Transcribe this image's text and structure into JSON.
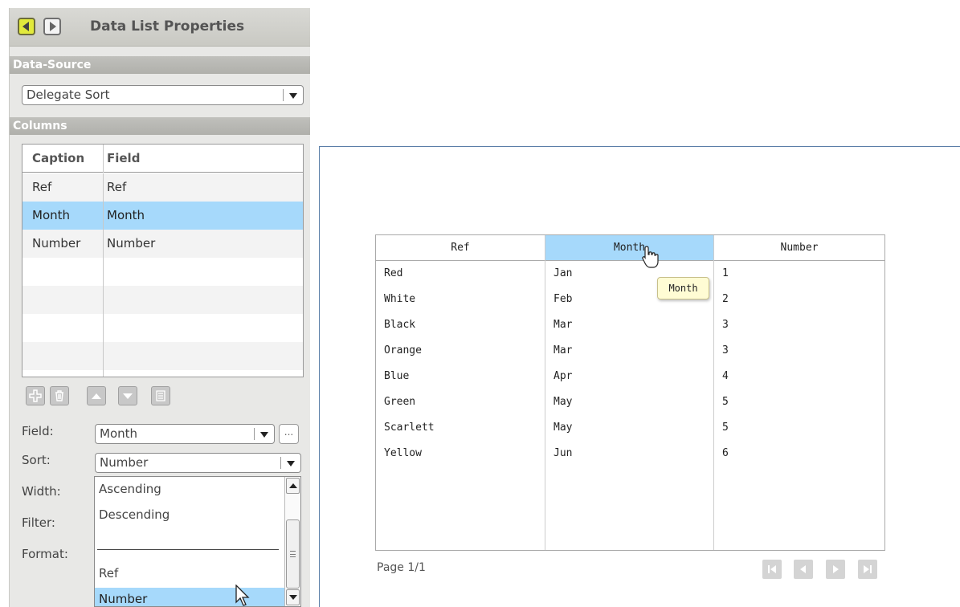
{
  "panel": {
    "title": "Data List Properties",
    "datasource_section": "Data-Source",
    "datasource_value": "Delegate Sort",
    "columns_section": "Columns",
    "columns_grid": {
      "headers": [
        "Caption",
        "Field"
      ],
      "rows": [
        {
          "caption": "Ref",
          "field": "Ref"
        },
        {
          "caption": "Month",
          "field": "Month"
        },
        {
          "caption": "Number",
          "field": "Number"
        }
      ],
      "selected_row": 1
    },
    "toolbar_icons": [
      "add-icon",
      "delete-icon",
      "move-up-icon",
      "move-down-icon",
      "list-icon"
    ],
    "properties": {
      "field_label": "Field:",
      "field_value": "Month",
      "ellipsis_label": "...",
      "sort_label": "Sort:",
      "sort_value": "Number",
      "width_label": "Width:",
      "filter_label": "Filter:",
      "format_label": "Format:"
    },
    "sort_dropdown": {
      "options": [
        "Ascending",
        "Descending",
        "Ref",
        "Number"
      ],
      "selected": "Number"
    }
  },
  "preview": {
    "table": {
      "headers": [
        "Ref",
        "Month",
        "Number"
      ],
      "active_header": 1,
      "rows": [
        [
          "Red",
          "Jan",
          "1"
        ],
        [
          "White",
          "Feb",
          "2"
        ],
        [
          "Black",
          "Mar",
          "3"
        ],
        [
          "Orange",
          "Mar",
          "3"
        ],
        [
          "Blue",
          "Apr",
          "4"
        ],
        [
          "Green",
          "May",
          "5"
        ],
        [
          "Scarlett",
          "May",
          "5"
        ],
        [
          "Yellow",
          "Jun",
          "6"
        ]
      ]
    },
    "tooltip": "Month",
    "page_label": "Page 1/1",
    "pager_icons": [
      "first-page-icon",
      "prev-page-icon",
      "next-page-icon",
      "last-page-icon"
    ]
  },
  "colors": {
    "selection": "#a6d9fb",
    "tooltip_bg": "#fffcd4",
    "nav_accent": "#e2ea3c",
    "preview_border": "#5a7ea8"
  }
}
